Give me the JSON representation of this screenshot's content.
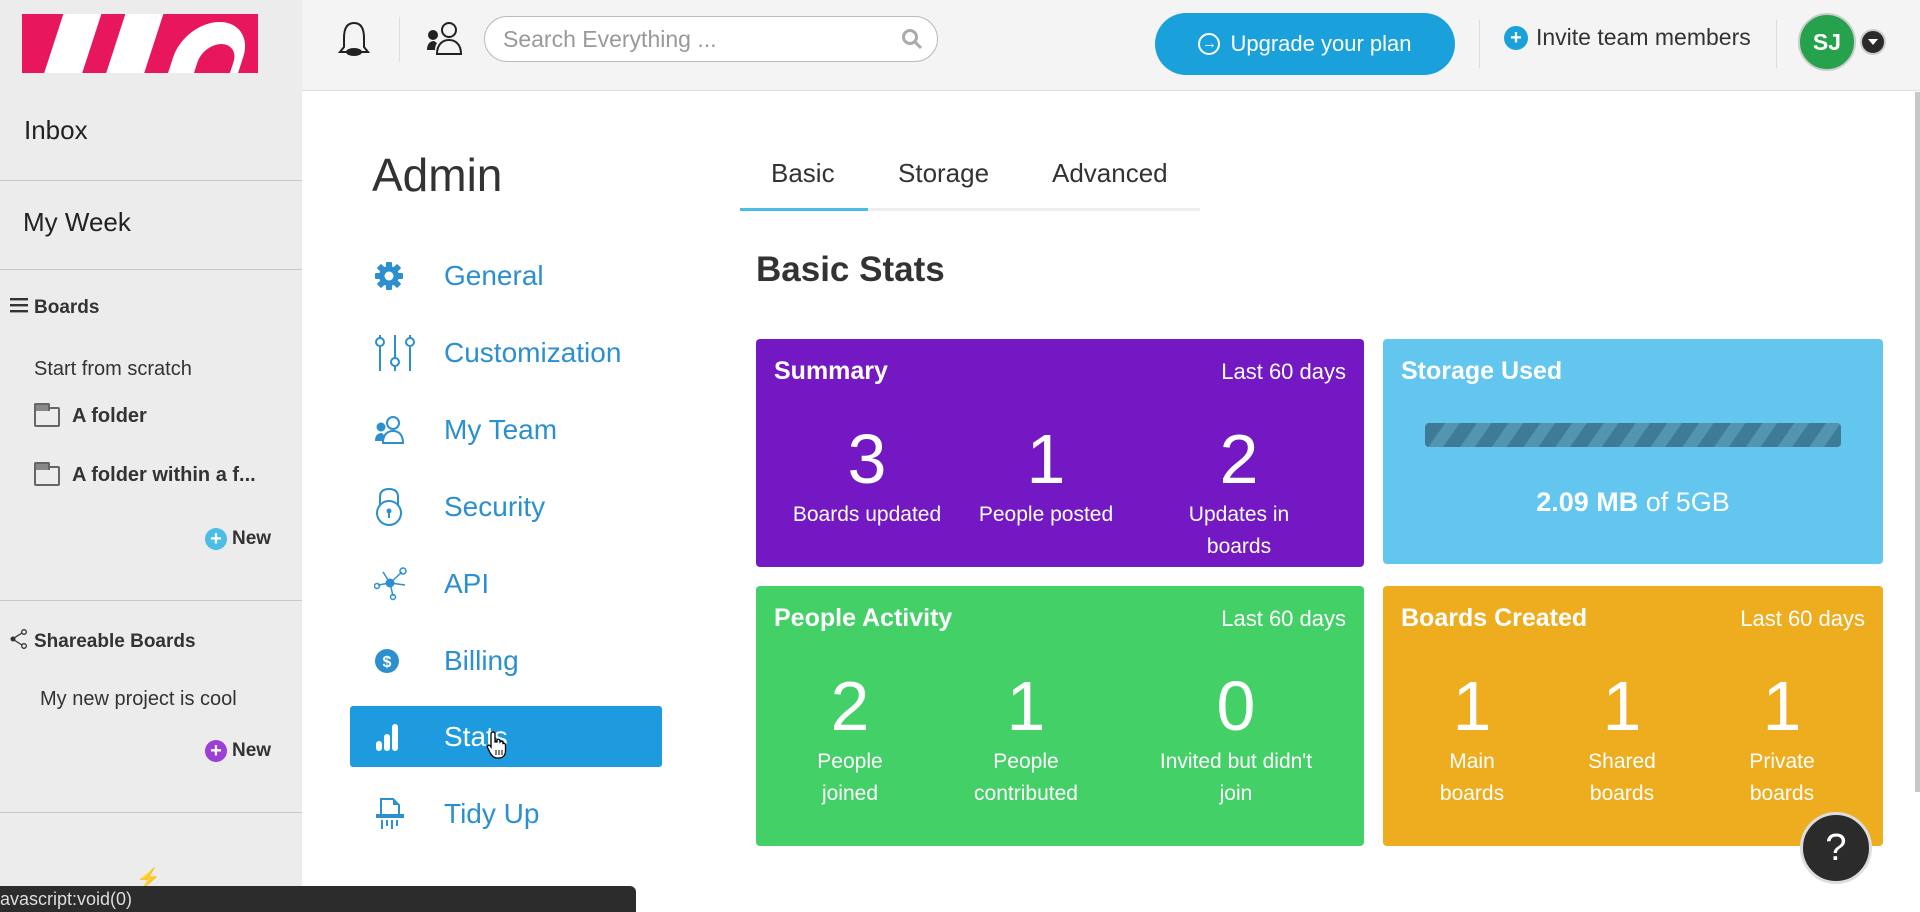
{
  "sidebar": {
    "inbox": "Inbox",
    "my_week": "My Week",
    "boards": {
      "heading": "Boards",
      "items": [
        {
          "label": "Start from scratch",
          "type": "board"
        },
        {
          "label": "A folder",
          "type": "folder"
        },
        {
          "label": "A folder within a f...",
          "type": "folder"
        }
      ],
      "new_label": "New"
    },
    "shareable": {
      "heading": "Shareable Boards",
      "items": [
        {
          "label": "My new project is cool"
        }
      ],
      "new_label": "New"
    }
  },
  "topbar": {
    "search_placeholder": "Search Everything ...",
    "upgrade_label": "Upgrade your plan",
    "invite_label": "Invite team members",
    "avatar_initials": "SJ"
  },
  "admin": {
    "title": "Admin",
    "nav": [
      {
        "label": "General",
        "icon": "gear-icon"
      },
      {
        "label": "Customization",
        "icon": "sliders-icon"
      },
      {
        "label": "My Team",
        "icon": "team-icon"
      },
      {
        "label": "Security",
        "icon": "lock-icon"
      },
      {
        "label": "API",
        "icon": "api-icon"
      },
      {
        "label": "Billing",
        "icon": "dollar-icon"
      },
      {
        "label": "Stats",
        "icon": "stats-icon",
        "active": true
      },
      {
        "label": "Tidy Up",
        "icon": "shredder-icon"
      }
    ]
  },
  "tabs": [
    {
      "label": "Basic",
      "active": true
    },
    {
      "label": "Storage"
    },
    {
      "label": "Advanced"
    }
  ],
  "section_title": "Basic Stats",
  "cards": {
    "summary": {
      "title": "Summary",
      "range": "Last 60 days",
      "color": "#7318c3",
      "stats": [
        {
          "value": "3",
          "label": "Boards updated"
        },
        {
          "value": "1",
          "label": "People posted"
        },
        {
          "value": "2",
          "label": "Updates in boards"
        }
      ]
    },
    "storage": {
      "title": "Storage Used",
      "color": "#62c6ee",
      "used": "2.09 MB",
      "of_text": "of 5GB",
      "fill_percent": 100
    },
    "people": {
      "title": "People Activity",
      "range": "Last 60 days",
      "color": "#43d067",
      "stats": [
        {
          "value": "2",
          "label": "People",
          "label2": "joined"
        },
        {
          "value": "1",
          "label": "People",
          "label2": "contributed"
        },
        {
          "value": "0",
          "label": "Invited but didn't",
          "label2": "join"
        }
      ]
    },
    "created": {
      "title": "Boards Created",
      "range": "Last 60 days",
      "color": "#eeac1f",
      "stats": [
        {
          "value": "1",
          "label": "Main",
          "label2": "boards"
        },
        {
          "value": "1",
          "label": "Shared",
          "label2": "boards"
        },
        {
          "value": "1",
          "label": "Private",
          "label2": "boards"
        }
      ]
    }
  },
  "help_label": "?",
  "status_bar": "avascript:void(0)"
}
